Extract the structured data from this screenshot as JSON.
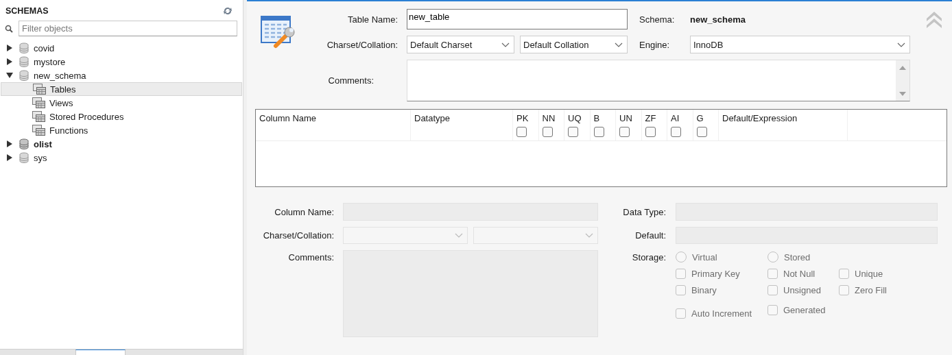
{
  "sidebar": {
    "title": "SCHEMAS",
    "filter": {
      "placeholder": "Filter objects"
    },
    "schemas": [
      {
        "name": "covid",
        "expanded": false,
        "default": false
      },
      {
        "name": "mystore",
        "expanded": false,
        "default": false
      },
      {
        "name": "new_schema",
        "expanded": true,
        "default": false,
        "children": [
          {
            "name": "Tables",
            "selected": true
          },
          {
            "name": "Views",
            "selected": false
          },
          {
            "name": "Stored Procedures",
            "selected": false
          },
          {
            "name": "Functions",
            "selected": false
          }
        ]
      },
      {
        "name": "olist",
        "expanded": false,
        "default": true
      },
      {
        "name": "sys",
        "expanded": false,
        "default": false
      }
    ],
    "tabs": [
      {
        "selected": false
      },
      {
        "selected": true
      }
    ]
  },
  "table_form": {
    "table_name_label": "Table Name:",
    "table_name": "new_table",
    "charset_label": "Charset/Collation:",
    "charset": "Default Charset",
    "collation": "Default Collation",
    "comments_label": "Comments:",
    "schema_label": "Schema:",
    "schema": "new_schema",
    "engine_label": "Engine:",
    "engine": "InnoDB"
  },
  "columns_grid": {
    "columns": [
      {
        "label": "Column Name",
        "kind": "text"
      },
      {
        "label": "Datatype",
        "kind": "text"
      },
      {
        "label": "PK",
        "kind": "flag",
        "checked": false
      },
      {
        "label": "NN",
        "kind": "flag",
        "checked": false
      },
      {
        "label": "UQ",
        "kind": "flag",
        "checked": false
      },
      {
        "label": "B",
        "kind": "flag",
        "checked": false
      },
      {
        "label": "UN",
        "kind": "flag",
        "checked": false
      },
      {
        "label": "ZF",
        "kind": "flag",
        "checked": false
      },
      {
        "label": "AI",
        "kind": "flag",
        "checked": false
      },
      {
        "label": "G",
        "kind": "flag",
        "checked": false
      },
      {
        "label": "Default/Expression",
        "kind": "text"
      }
    ]
  },
  "column_details": {
    "column_name_label": "Column Name:",
    "charset_label": "Charset/Collation:",
    "comments_label": "Comments:",
    "data_type_label": "Data Type:",
    "default_label": "Default:",
    "storage_label": "Storage:",
    "options": [
      {
        "label": "Virtual",
        "kind": "radio",
        "checked": false,
        "disabled": true
      },
      {
        "label": "Stored",
        "kind": "radio",
        "checked": false,
        "disabled": true
      },
      {
        "label": "Primary Key",
        "kind": "checkbox",
        "checked": false,
        "disabled": true
      },
      {
        "label": "Not Null",
        "kind": "checkbox",
        "checked": false,
        "disabled": true
      },
      {
        "label": "Unique",
        "kind": "checkbox",
        "checked": false,
        "disabled": true
      },
      {
        "label": "Binary",
        "kind": "checkbox",
        "checked": false,
        "disabled": true
      },
      {
        "label": "Unsigned",
        "kind": "checkbox",
        "checked": false,
        "disabled": true
      },
      {
        "label": "Zero Fill",
        "kind": "checkbox",
        "checked": false,
        "disabled": true
      },
      {
        "label": "Auto Increment",
        "kind": "checkbox",
        "checked": false,
        "disabled": true
      },
      {
        "label": "Generated",
        "kind": "checkbox",
        "checked": false,
        "disabled": true
      }
    ]
  }
}
